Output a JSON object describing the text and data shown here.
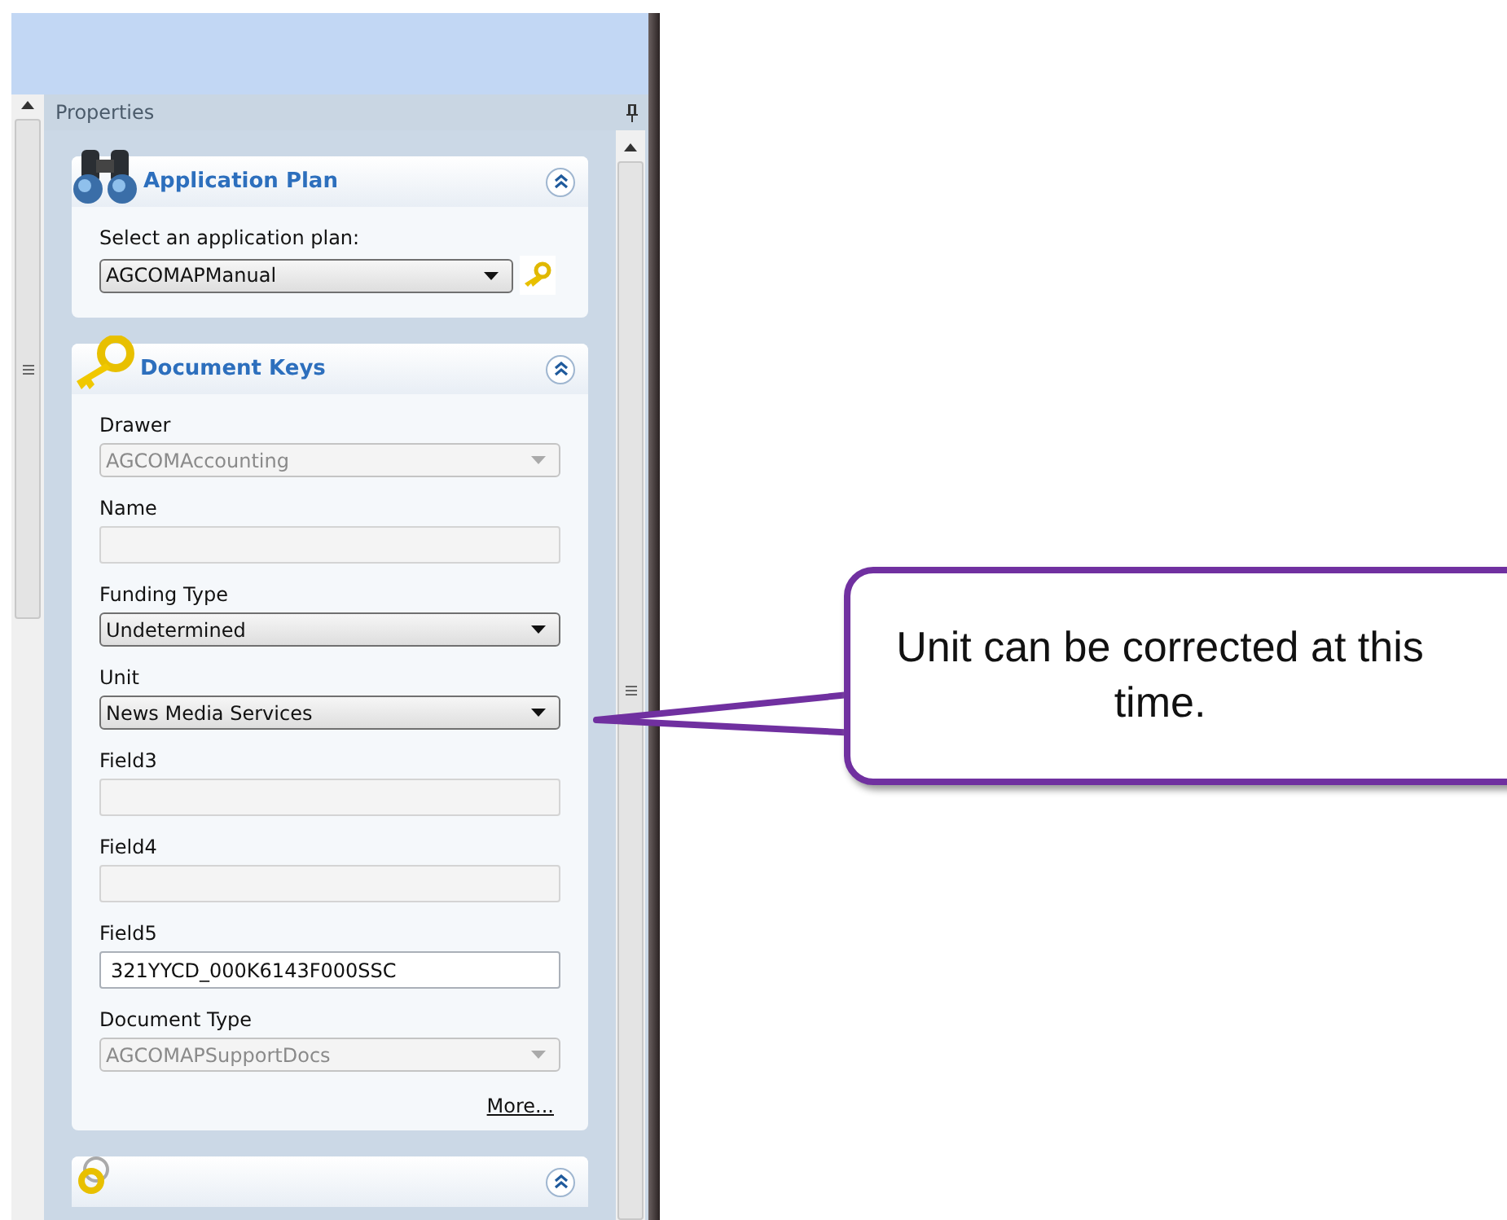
{
  "panel": {
    "title": "Properties"
  },
  "sections": [
    {
      "title": "Application Plan",
      "expanded": true,
      "prompt": "Select an application plan:",
      "plan": {
        "value": "AGCOMAPManual"
      }
    },
    {
      "title": "Document Keys",
      "expanded": true,
      "fields": [
        {
          "label": "Drawer",
          "kind": "dropdown",
          "value": "AGCOMAccounting",
          "disabled": true
        },
        {
          "label": "Name",
          "kind": "text",
          "disabled": true
        },
        {
          "label": "Funding Type",
          "kind": "dropdown",
          "value": "Undetermined",
          "disabled": false
        },
        {
          "label": "Unit",
          "kind": "dropdown",
          "value": "News Media Services",
          "disabled": false
        },
        {
          "label": "Field3",
          "kind": "text",
          "disabled": true
        },
        {
          "label": "Field4",
          "kind": "text",
          "disabled": true
        },
        {
          "label": "Field5",
          "kind": "text",
          "value": "321YYCD_000K6143F000SSC",
          "disabled": false
        },
        {
          "label": "Document Type",
          "kind": "dropdown",
          "value": "AGCOMAPSupportDocs",
          "disabled": true
        }
      ],
      "link": "More..."
    },
    {
      "expanded": true
    }
  ],
  "callout": {
    "text": "Unit can be corrected at this time."
  }
}
